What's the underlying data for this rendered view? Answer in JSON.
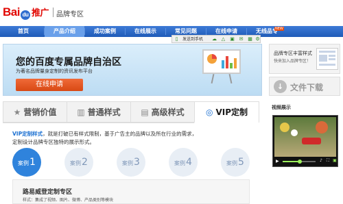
{
  "header": {
    "logo_text_1": "Bai",
    "logo_paw": "du",
    "logo_text_2": "推广",
    "zone_title": "品牌专区"
  },
  "nav": {
    "items": [
      {
        "label": "首页",
        "active": false
      },
      {
        "label": "产品介绍",
        "active": true
      },
      {
        "label": "成功案例",
        "active": false
      },
      {
        "label": "在线展示",
        "active": false
      },
      {
        "label": "常见问题",
        "active": false
      },
      {
        "label": "在线申请",
        "active": false
      },
      {
        "label": "无线品专",
        "active": false
      }
    ],
    "new_badge": "NEW"
  },
  "toolbar": {
    "send_label": "发送到手机"
  },
  "banner": {
    "title": "您的百度专属品牌自治区",
    "subtitle": "为著名品牌量身定制的资讯发布平台",
    "apply_button": "在线申请"
  },
  "side": {
    "rich_title": "品牌专区丰富样式",
    "rich_sub": "快来加入品牌专区！",
    "download_label": "文件下载",
    "video_title": "视频展示"
  },
  "tabs": [
    {
      "icon": "★",
      "label": "营销价值",
      "active": false
    },
    {
      "icon": "▥",
      "label": "普通样式",
      "active": false
    },
    {
      "icon": "▤",
      "label": "高级样式",
      "active": false
    },
    {
      "icon": "◎",
      "label": "VIP定制",
      "active": true
    }
  ],
  "description": {
    "highlight": "VIP定制样式",
    "text_1": "，就是打破已有样式限制，基于广告主的品牌以及所在行业的需求，",
    "text_2": "定制设计品牌专区独特的展示形式。"
  },
  "cases": [
    {
      "label": "案例",
      "num": "1",
      "active": true
    },
    {
      "label": "案例",
      "num": "2",
      "active": false
    },
    {
      "label": "案例",
      "num": "3",
      "active": false
    },
    {
      "label": "案例",
      "num": "4",
      "active": false
    },
    {
      "label": "案例",
      "num": "5",
      "active": false
    }
  ],
  "case_panel": {
    "title": "路易威登定制专区",
    "sub": "样式：集成了视频、图片、微博、产品类别等模块"
  },
  "colors": {
    "brand_red": "#e10601",
    "nav_blue": "#1f5bb8",
    "accent_orange": "#d84914",
    "case_blue": "#2f83dc"
  }
}
